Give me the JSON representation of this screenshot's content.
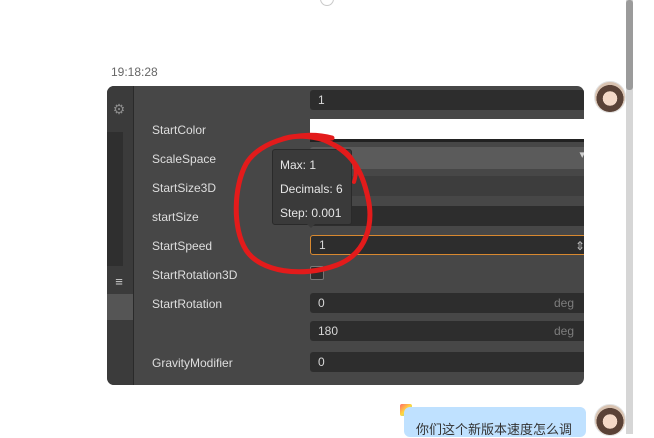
{
  "chat": {
    "timestamp": "19:18:28",
    "message": "你们这个新版本速度怎么调"
  },
  "inspector": {
    "top_value": "1",
    "rows": [
      {
        "label": "StartColor"
      },
      {
        "label": "ScaleSpace"
      },
      {
        "label": "StartSize3D"
      },
      {
        "label": "startSize"
      },
      {
        "label": "StartSpeed",
        "value": "1"
      },
      {
        "label": "StartRotation3D"
      },
      {
        "label": "StartRotation",
        "values": [
          "0",
          "180"
        ],
        "unit": "deg"
      },
      {
        "label": "GravityModifier",
        "value": "0"
      }
    ],
    "tooltip": {
      "max": "Max: 1",
      "decimals": "Decimals: 6",
      "step": "Step: 0.001"
    },
    "icons": [
      "gear-icon",
      "menu-icon",
      "chevron-down-icon",
      "stepper-icon"
    ]
  },
  "annotation_color": "#e31b1b",
  "bubble_color": "#bfe1ff"
}
